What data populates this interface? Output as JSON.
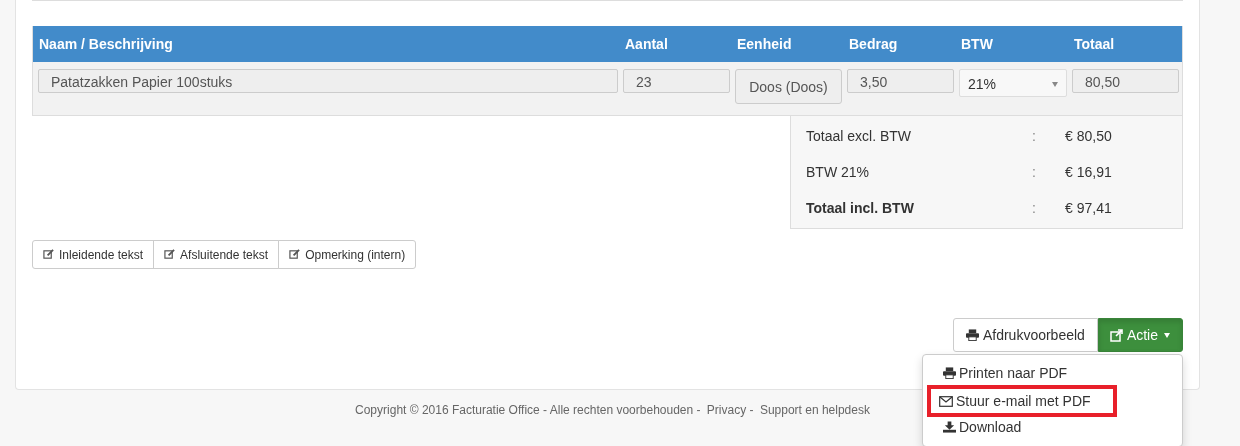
{
  "table": {
    "columns": [
      "Naam / Beschrijving",
      "Aantal",
      "Eenheid",
      "Bedrag",
      "BTW",
      "Totaal"
    ],
    "rows": [
      {
        "name": "Patatzakken Papier 100stuks",
        "quantity": "23",
        "unit": "Doos (Doos)",
        "amount": "3,50",
        "vat": "21%",
        "total": "80,50"
      }
    ]
  },
  "totals": [
    {
      "label": "Totaal excl. BTW",
      "separator": ":",
      "value": "€ 80,50",
      "bold": false
    },
    {
      "label": "BTW 21%",
      "separator": ":",
      "value": "€ 16,91",
      "bold": false
    },
    {
      "label": "Totaal incl. BTW",
      "separator": ":",
      "value": "€ 97,41",
      "bold": true
    }
  ],
  "text_buttons": [
    "Inleidende tekst",
    "Afsluitende tekst",
    "Opmerking (intern)"
  ],
  "actions": {
    "preview": "Afdrukvoorbeeld",
    "action": "Actie",
    "expanded": true
  },
  "menu": [
    {
      "label": "Printen naar PDF",
      "kind": "print",
      "highlighted": false
    },
    {
      "label": "Stuur e-mail met PDF",
      "kind": "mail",
      "highlighted": true
    },
    {
      "label": "Download",
      "kind": "download",
      "highlighted": false
    }
  ],
  "footer": {
    "text": "Copyright © 2016 Facturatie Office - Alle rechten voorbehouden - ",
    "links": [
      {
        "label": "Privacy",
        "suffix": " - "
      },
      {
        "label": "Support en helpdesk"
      }
    ]
  }
}
